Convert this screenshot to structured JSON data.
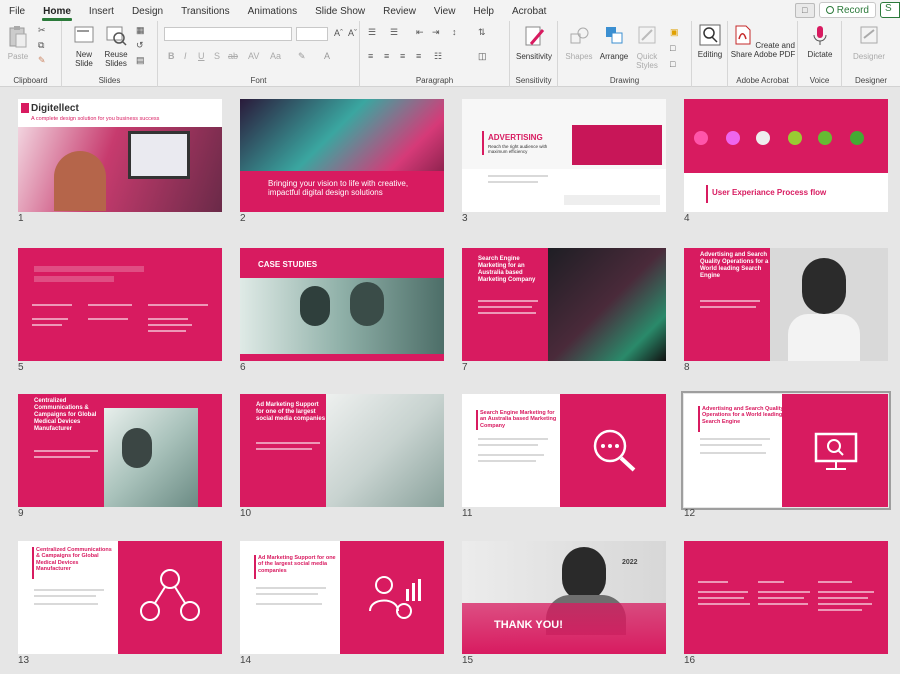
{
  "tabs": [
    "File",
    "Home",
    "Insert",
    "Design",
    "Transitions",
    "Animations",
    "Slide Show",
    "Review",
    "View",
    "Help",
    "Acrobat"
  ],
  "active_tab": "Home",
  "record_label": "Record",
  "share_label": "S",
  "ribbon": {
    "clipboard": {
      "label": "Clipboard",
      "paste": "Paste"
    },
    "slides": {
      "label": "Slides",
      "new_slide": "New Slide",
      "reuse_slides": "Reuse Slides"
    },
    "font": {
      "label": "Font"
    },
    "paragraph": {
      "label": "Paragraph"
    },
    "sensitivity": {
      "label": "Sensitivity",
      "button": "Sensitivity"
    },
    "drawing": {
      "label": "Drawing",
      "shapes": "Shapes",
      "arrange": "Arrange",
      "quick_styles": "Quick Styles"
    },
    "editing": {
      "button": "Editing"
    },
    "adobe": {
      "label": "Adobe Acrobat",
      "button": "Create and Share Adobe PDF"
    },
    "voice": {
      "label": "Voice",
      "button": "Dictate"
    },
    "designer": {
      "label": "Designer",
      "button": "Designer"
    }
  },
  "colors": {
    "accent": "#d81b60",
    "accent_dark": "#b0124e",
    "tab_green": "#2b7a3a"
  },
  "slides": [
    {
      "num": "1",
      "logo": "Digitellect",
      "subtitle": "A complete design solution for you business success"
    },
    {
      "num": "2",
      "title": "Bringing your vision to life with creative, impactful digital design solutions"
    },
    {
      "num": "3",
      "title": "ADVERTISING",
      "subtitle": "Reach the right audience with maximum efficiency"
    },
    {
      "num": "4",
      "title": "User Experiance Process flow"
    },
    {
      "num": "5",
      "title": ""
    },
    {
      "num": "6",
      "title": "CASE STUDIES"
    },
    {
      "num": "7",
      "title": "Search Engine Marketing for an Australia based Marketing Company"
    },
    {
      "num": "8",
      "title": "Advertising and Search Quality Operations for a World leading Search Engine"
    },
    {
      "num": "9",
      "title": "Centralized Communications & Campaigns for Global Medical Devices Manufacturer"
    },
    {
      "num": "10",
      "title": "Ad Marketing Support for one of the largest social media companies"
    },
    {
      "num": "11",
      "title": "Search Engine Marketing for an Australia based Marketing Company"
    },
    {
      "num": "12",
      "title": "Advertising and Search Quality Operations for a World leading Search Engine"
    },
    {
      "num": "13",
      "title": "Centralized Communications & Campaigns for Global Medical Devices Manufacturer"
    },
    {
      "num": "14",
      "title": "Ad Marketing Support for one of the largest social media companies"
    },
    {
      "num": "15",
      "title": "THANK YOU!",
      "year": "2022"
    },
    {
      "num": "16",
      "title": ""
    }
  ]
}
